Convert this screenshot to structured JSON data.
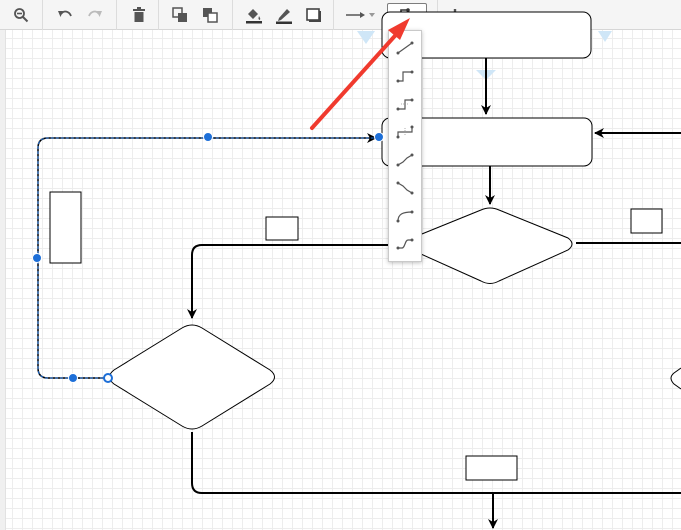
{
  "toolbar": {
    "items": [
      {
        "name": "zoom-out-icon"
      },
      {
        "name": "undo-icon"
      },
      {
        "name": "redo-icon"
      },
      {
        "name": "delete-icon"
      },
      {
        "name": "to-front-icon"
      },
      {
        "name": "to-back-icon"
      },
      {
        "name": "fill-color-icon"
      },
      {
        "name": "line-color-icon"
      },
      {
        "name": "shadow-icon"
      },
      {
        "name": "connection-style-icon"
      },
      {
        "name": "waypoints-icon"
      },
      {
        "name": "insert-icon"
      }
    ]
  },
  "waypoints_menu": {
    "items": [
      {
        "name": "straight-waypoint-icon"
      },
      {
        "name": "orthogonal-waypoint-icon"
      },
      {
        "name": "horizontal-elbow-waypoint-icon"
      },
      {
        "name": "vertical-elbow-waypoint-icon"
      },
      {
        "name": "isometric-waypoint-icon"
      },
      {
        "name": "isometric-vertical-waypoint-icon"
      },
      {
        "name": "curved-waypoint-icon"
      },
      {
        "name": "entity-relation-waypoint-icon"
      }
    ]
  },
  "colors": {
    "selection": "#1d6fd8",
    "annotation_arrow": "#f03a2e",
    "edge": "#000000"
  }
}
